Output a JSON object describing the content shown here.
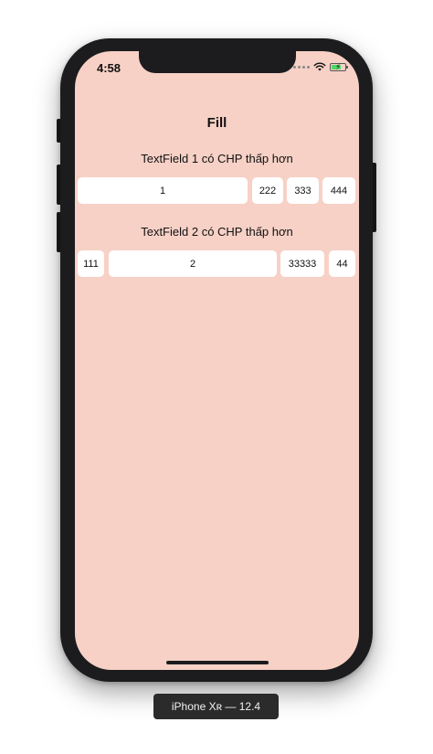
{
  "status_bar": {
    "time": "4:58"
  },
  "nav": {
    "title": "Fill"
  },
  "section1": {
    "label": "TextField 1 có CHP thấp hơn",
    "fields": [
      "1",
      "222",
      "333",
      "444"
    ]
  },
  "section2": {
    "label": "TextField 2 có CHP thấp hơn",
    "fields": [
      "111",
      "2",
      "33333",
      "44"
    ]
  },
  "device": {
    "label": "iPhone Xʀ — 12.4"
  },
  "colors": {
    "background": "#f7d1c6",
    "field_background": "#ffffff",
    "frame": "#1c1c1e",
    "battery": "#4cd964"
  },
  "icons": [
    "signal-icon",
    "wifi-icon",
    "battery-charging-icon"
  ]
}
